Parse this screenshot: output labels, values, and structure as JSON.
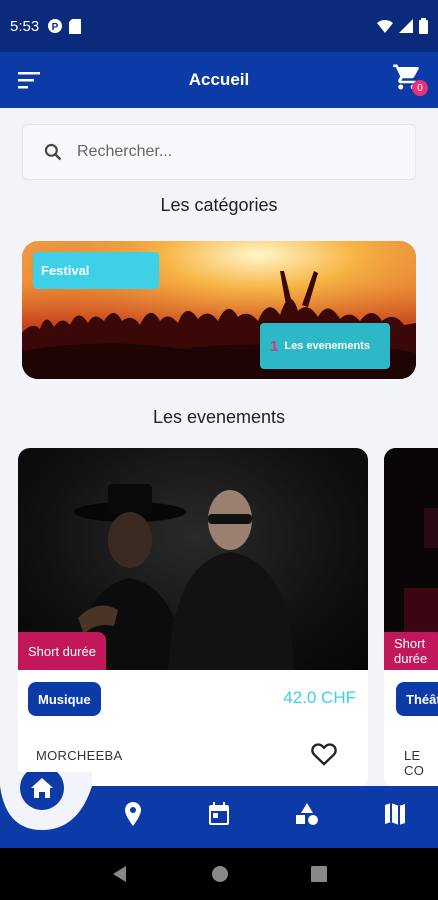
{
  "status_bar": {
    "time": "5:53"
  },
  "app_bar": {
    "title": "Accueil",
    "cart_count": "0"
  },
  "search": {
    "placeholder": "Rechercher..."
  },
  "categories": {
    "title": "Les catégories",
    "items": [
      {
        "tag": "Festival",
        "count": "1",
        "count_label": "Les evenements"
      }
    ]
  },
  "events": {
    "title": "Les evenements",
    "items": [
      {
        "badge": "Short durée",
        "category": "Musique",
        "price": "42.0 CHF",
        "name": "MORCHEEBA"
      },
      {
        "badge": "Short durée",
        "category": "Théât",
        "name": "LE CO"
      }
    ]
  },
  "colors": {
    "primary": "#0c3aa6",
    "accent": "#3ed0e6",
    "pink": "#c2185b"
  },
  "bottom_nav": {
    "items": [
      "home-icon",
      "location-icon",
      "calendar-icon",
      "shapes-icon",
      "map-icon"
    ]
  }
}
